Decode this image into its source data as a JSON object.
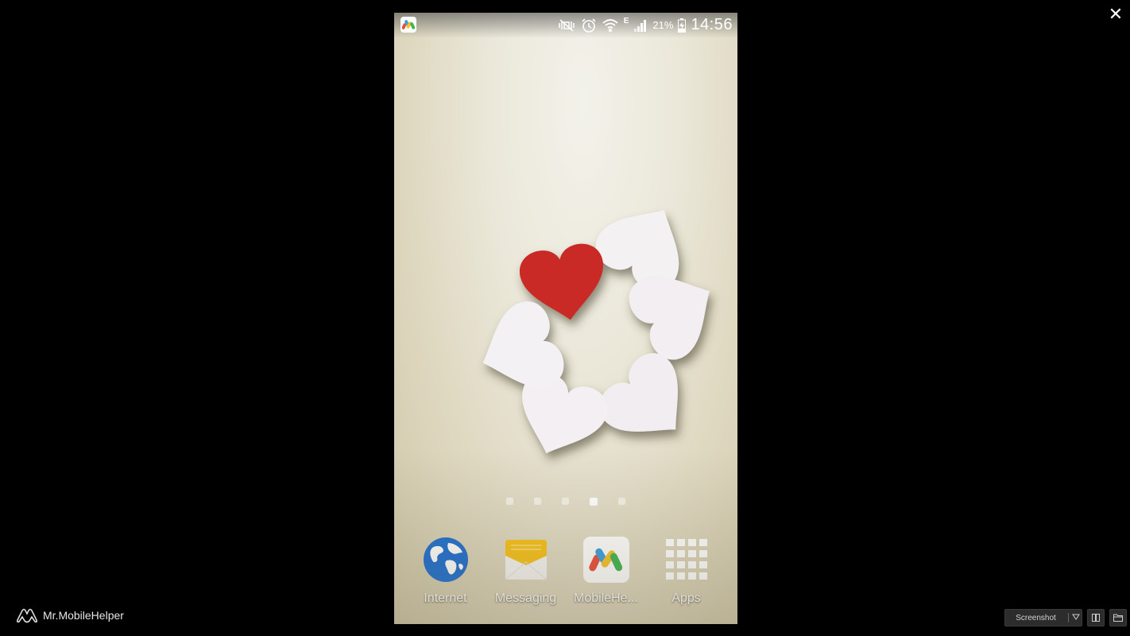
{
  "window": {
    "close_label": "✕"
  },
  "brand": {
    "name": "Mr.MobileHelper"
  },
  "toolbar": {
    "screenshot_label": "Screenshot",
    "dropdown_icon": "triangle-down-icon",
    "layout_icon": "split-view-icon",
    "folder_icon": "folder-icon"
  },
  "phone": {
    "statusbar": {
      "notification_app_icon": "mobilehelper-icon",
      "icons": [
        "mute-vibrate-icon",
        "alarm-icon",
        "wifi-icon",
        "network-e-icon",
        "signal-icon",
        "battery-charging-icon"
      ],
      "network_type": "E",
      "battery_percent": "21%",
      "time": "14:56"
    },
    "home": {
      "page_count": 5,
      "active_page_index": 3
    },
    "dock": [
      {
        "label": "Internet",
        "icon": "globe-icon"
      },
      {
        "label": "Messaging",
        "icon": "envelope-icon"
      },
      {
        "label": "MobileHe...",
        "icon": "mobilehelper-icon"
      },
      {
        "label": "Apps",
        "icon": "apps-grid-icon"
      }
    ]
  }
}
